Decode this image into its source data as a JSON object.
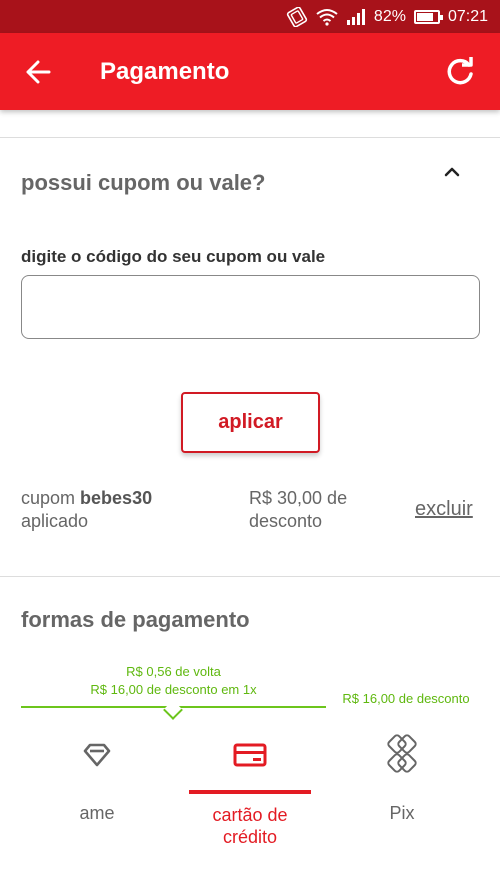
{
  "status_bar": {
    "battery": "82%",
    "time": "07:21",
    "battery_level": 0.82
  },
  "app_bar": {
    "title": "Pagamento"
  },
  "coupon": {
    "section_title": "possui cupom ou vale?",
    "field_label": "digite o código do seu cupom ou vale",
    "field_value": "",
    "apply_label": "aplicar",
    "applied_prefix": "cupom",
    "applied_code": "bebes30",
    "applied_suffix": "aplicado",
    "discount_text": "R$ 30,00 de desconto",
    "remove_label": "excluir"
  },
  "payment": {
    "section_title": "formas de pagamento",
    "promo_card_line1": "R$ 0,56 de volta",
    "promo_card_line2": "R$ 16,00 de desconto em 1x",
    "promo_pix": "R$ 16,00 de desconto",
    "methods": [
      {
        "label": "ame",
        "icon": "ame-icon"
      },
      {
        "label": "cartão de crédito",
        "icon": "credit-card-icon",
        "selected": true
      },
      {
        "label": "Pix",
        "icon": "pix-icon"
      }
    ]
  },
  "colors": {
    "brand_red": "#ee1c25",
    "status_red": "#a8121a",
    "promo_green": "#5fb80f"
  }
}
